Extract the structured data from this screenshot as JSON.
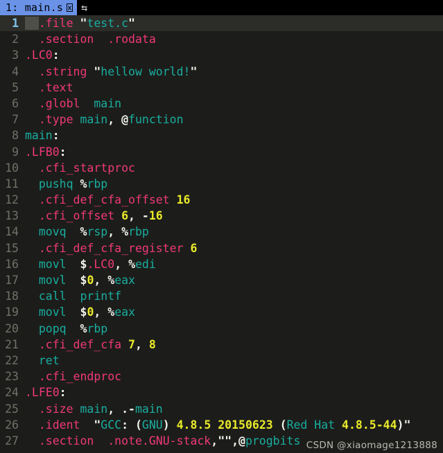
{
  "tabbar": {
    "tabs": [
      {
        "label": "1: main.s",
        "modified_glyph": "modified-box-glyph",
        "active": true
      }
    ],
    "toggle_icon": "⇆",
    "toggle_icon_name": "split-swap-icon"
  },
  "editor": {
    "cursor_line": 1,
    "colors": {
      "background": "#1c1d1a",
      "cursorline_background": "#2c2d29",
      "gutter_text": "#6f7168",
      "cursor_line_number": "#7fc4e8",
      "directive": "#f0387b",
      "identifier": "#1aada0",
      "number": "#eaea2a",
      "punctuation": "#f2f2ec",
      "tab_active_background": "#6a93e8"
    },
    "lines": [
      {
        "n": "1",
        "tokens": [
          {
            "t": "  ",
            "c": "cursor"
          },
          {
            "t": ".file",
            "c": "dir"
          },
          {
            "t": " ",
            "c": "plain"
          },
          {
            "t": "\"",
            "c": "pun"
          },
          {
            "t": "test.c",
            "c": "id"
          },
          {
            "t": "\"",
            "c": "pun"
          }
        ]
      },
      {
        "n": "2",
        "tokens": [
          {
            "t": "  ",
            "c": "plain"
          },
          {
            "t": ".section",
            "c": "dir"
          },
          {
            "t": "  ",
            "c": "plain"
          },
          {
            "t": ".rodata",
            "c": "dir"
          }
        ]
      },
      {
        "n": "3",
        "tokens": [
          {
            "t": ".LC0",
            "c": "dir"
          },
          {
            "t": ":",
            "c": "pun"
          }
        ]
      },
      {
        "n": "4",
        "tokens": [
          {
            "t": "  ",
            "c": "plain"
          },
          {
            "t": ".string",
            "c": "dir"
          },
          {
            "t": " ",
            "c": "plain"
          },
          {
            "t": "\"",
            "c": "pun"
          },
          {
            "t": "hellow world!",
            "c": "id"
          },
          {
            "t": "\"",
            "c": "pun"
          }
        ]
      },
      {
        "n": "5",
        "tokens": [
          {
            "t": "  ",
            "c": "plain"
          },
          {
            "t": ".text",
            "c": "dir"
          }
        ]
      },
      {
        "n": "6",
        "tokens": [
          {
            "t": "  ",
            "c": "plain"
          },
          {
            "t": ".globl",
            "c": "dir"
          },
          {
            "t": "  ",
            "c": "plain"
          },
          {
            "t": "main",
            "c": "id"
          }
        ]
      },
      {
        "n": "7",
        "tokens": [
          {
            "t": "  ",
            "c": "plain"
          },
          {
            "t": ".type",
            "c": "dir"
          },
          {
            "t": " ",
            "c": "plain"
          },
          {
            "t": "main",
            "c": "id"
          },
          {
            "t": ",",
            "c": "pun"
          },
          {
            "t": " ",
            "c": "plain"
          },
          {
            "t": "@",
            "c": "pun"
          },
          {
            "t": "function",
            "c": "id"
          }
        ]
      },
      {
        "n": "8",
        "tokens": [
          {
            "t": "main",
            "c": "id"
          },
          {
            "t": ":",
            "c": "pun"
          }
        ]
      },
      {
        "n": "9",
        "tokens": [
          {
            "t": ".LFB0",
            "c": "dir"
          },
          {
            "t": ":",
            "c": "pun"
          }
        ]
      },
      {
        "n": "10",
        "tokens": [
          {
            "t": "  ",
            "c": "plain"
          },
          {
            "t": ".cfi_startproc",
            "c": "dir"
          }
        ]
      },
      {
        "n": "11",
        "tokens": [
          {
            "t": "  ",
            "c": "plain"
          },
          {
            "t": "pushq",
            "c": "id"
          },
          {
            "t": " ",
            "c": "plain"
          },
          {
            "t": "%",
            "c": "pun"
          },
          {
            "t": "rbp",
            "c": "id"
          }
        ]
      },
      {
        "n": "12",
        "tokens": [
          {
            "t": "  ",
            "c": "plain"
          },
          {
            "t": ".cfi_def_cfa_offset",
            "c": "dir"
          },
          {
            "t": " ",
            "c": "plain"
          },
          {
            "t": "16",
            "c": "num"
          }
        ]
      },
      {
        "n": "13",
        "tokens": [
          {
            "t": "  ",
            "c": "plain"
          },
          {
            "t": ".cfi_offset",
            "c": "dir"
          },
          {
            "t": " ",
            "c": "plain"
          },
          {
            "t": "6",
            "c": "num"
          },
          {
            "t": ",",
            "c": "pun"
          },
          {
            "t": " ",
            "c": "plain"
          },
          {
            "t": "-",
            "c": "pun"
          },
          {
            "t": "16",
            "c": "num"
          }
        ]
      },
      {
        "n": "14",
        "tokens": [
          {
            "t": "  ",
            "c": "plain"
          },
          {
            "t": "movq",
            "c": "id"
          },
          {
            "t": "  ",
            "c": "plain"
          },
          {
            "t": "%",
            "c": "pun"
          },
          {
            "t": "rsp",
            "c": "id"
          },
          {
            "t": ",",
            "c": "pun"
          },
          {
            "t": " ",
            "c": "plain"
          },
          {
            "t": "%",
            "c": "pun"
          },
          {
            "t": "rbp",
            "c": "id"
          }
        ]
      },
      {
        "n": "15",
        "tokens": [
          {
            "t": "  ",
            "c": "plain"
          },
          {
            "t": ".cfi_def_cfa_register",
            "c": "dir"
          },
          {
            "t": " ",
            "c": "plain"
          },
          {
            "t": "6",
            "c": "num"
          }
        ]
      },
      {
        "n": "16",
        "tokens": [
          {
            "t": "  ",
            "c": "plain"
          },
          {
            "t": "movl",
            "c": "id"
          },
          {
            "t": "  ",
            "c": "plain"
          },
          {
            "t": "$",
            "c": "pun"
          },
          {
            "t": ".LC0",
            "c": "dir"
          },
          {
            "t": ",",
            "c": "pun"
          },
          {
            "t": " ",
            "c": "plain"
          },
          {
            "t": "%",
            "c": "pun"
          },
          {
            "t": "edi",
            "c": "id"
          }
        ]
      },
      {
        "n": "17",
        "tokens": [
          {
            "t": "  ",
            "c": "plain"
          },
          {
            "t": "movl",
            "c": "id"
          },
          {
            "t": "  ",
            "c": "plain"
          },
          {
            "t": "$",
            "c": "pun"
          },
          {
            "t": "0",
            "c": "num"
          },
          {
            "t": ",",
            "c": "pun"
          },
          {
            "t": " ",
            "c": "plain"
          },
          {
            "t": "%",
            "c": "pun"
          },
          {
            "t": "eax",
            "c": "id"
          }
        ]
      },
      {
        "n": "18",
        "tokens": [
          {
            "t": "  ",
            "c": "plain"
          },
          {
            "t": "call",
            "c": "id"
          },
          {
            "t": "  ",
            "c": "plain"
          },
          {
            "t": "printf",
            "c": "id"
          }
        ]
      },
      {
        "n": "19",
        "tokens": [
          {
            "t": "  ",
            "c": "plain"
          },
          {
            "t": "movl",
            "c": "id"
          },
          {
            "t": "  ",
            "c": "plain"
          },
          {
            "t": "$",
            "c": "pun"
          },
          {
            "t": "0",
            "c": "num"
          },
          {
            "t": ",",
            "c": "pun"
          },
          {
            "t": " ",
            "c": "plain"
          },
          {
            "t": "%",
            "c": "pun"
          },
          {
            "t": "eax",
            "c": "id"
          }
        ]
      },
      {
        "n": "20",
        "tokens": [
          {
            "t": "  ",
            "c": "plain"
          },
          {
            "t": "popq",
            "c": "id"
          },
          {
            "t": "  ",
            "c": "plain"
          },
          {
            "t": "%",
            "c": "pun"
          },
          {
            "t": "rbp",
            "c": "id"
          }
        ]
      },
      {
        "n": "21",
        "tokens": [
          {
            "t": "  ",
            "c": "plain"
          },
          {
            "t": ".cfi_def_cfa",
            "c": "dir"
          },
          {
            "t": " ",
            "c": "plain"
          },
          {
            "t": "7",
            "c": "num"
          },
          {
            "t": ",",
            "c": "pun"
          },
          {
            "t": " ",
            "c": "plain"
          },
          {
            "t": "8",
            "c": "num"
          }
        ]
      },
      {
        "n": "22",
        "tokens": [
          {
            "t": "  ",
            "c": "plain"
          },
          {
            "t": "ret",
            "c": "id"
          }
        ]
      },
      {
        "n": "23",
        "tokens": [
          {
            "t": "  ",
            "c": "plain"
          },
          {
            "t": ".cfi_endproc",
            "c": "dir"
          }
        ]
      },
      {
        "n": "24",
        "tokens": [
          {
            "t": ".LFE0",
            "c": "dir"
          },
          {
            "t": ":",
            "c": "pun"
          }
        ]
      },
      {
        "n": "25",
        "tokens": [
          {
            "t": "  ",
            "c": "plain"
          },
          {
            "t": ".size",
            "c": "dir"
          },
          {
            "t": " ",
            "c": "plain"
          },
          {
            "t": "main",
            "c": "id"
          },
          {
            "t": ",",
            "c": "pun"
          },
          {
            "t": " ",
            "c": "plain"
          },
          {
            "t": ".-",
            "c": "pun"
          },
          {
            "t": "main",
            "c": "id"
          }
        ]
      },
      {
        "n": "26",
        "tokens": [
          {
            "t": "  ",
            "c": "plain"
          },
          {
            "t": ".ident",
            "c": "dir"
          },
          {
            "t": "  ",
            "c": "plain"
          },
          {
            "t": "\"",
            "c": "pun"
          },
          {
            "t": "GCC",
            "c": "id"
          },
          {
            "t": ": ",
            "c": "pun"
          },
          {
            "t": "(",
            "c": "pun"
          },
          {
            "t": "GNU",
            "c": "id"
          },
          {
            "t": ") ",
            "c": "pun"
          },
          {
            "t": "4.8.5 20150623",
            "c": "num"
          },
          {
            "t": " (",
            "c": "pun"
          },
          {
            "t": "Red Hat",
            "c": "id"
          },
          {
            "t": " ",
            "c": "plain"
          },
          {
            "t": "4.8.5-44",
            "c": "num"
          },
          {
            "t": ")",
            "c": "pun"
          },
          {
            "t": "\"",
            "c": "pun"
          }
        ]
      },
      {
        "n": "27",
        "tokens": [
          {
            "t": "  ",
            "c": "plain"
          },
          {
            "t": ".section",
            "c": "dir"
          },
          {
            "t": "  ",
            "c": "plain"
          },
          {
            "t": ".note.GNU-stack",
            "c": "dir"
          },
          {
            "t": ",",
            "c": "pun"
          },
          {
            "t": "\"\"",
            "c": "pun"
          },
          {
            "t": ",",
            "c": "pun"
          },
          {
            "t": "@",
            "c": "pun"
          },
          {
            "t": "progbits",
            "c": "id"
          }
        ]
      }
    ]
  },
  "watermark": {
    "text": "CSDN @xiaomage1213888"
  }
}
